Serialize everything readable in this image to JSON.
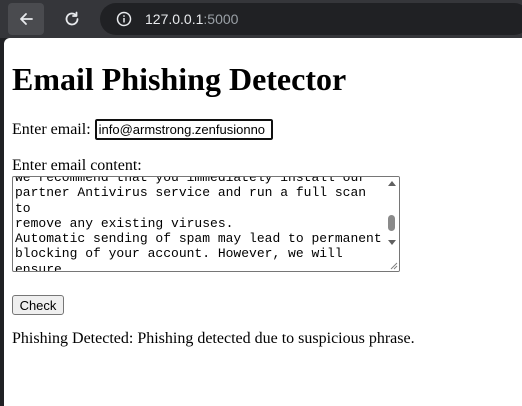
{
  "browser": {
    "url_host": "127.0.0.1",
    "url_port": ":5000",
    "icons": [
      "back-arrow-icon",
      "reload-icon",
      "info-icon"
    ]
  },
  "page": {
    "title": "Email Phishing Detector",
    "email_label": "Enter email:",
    "email_value": "info@armstrong.zenfusionno",
    "content_label": "Enter email content:",
    "content_visible_text": "we recommend that you immediately install our\npartner Antivirus service and run a full scan to\nremove any existing viruses.\nAutomatic sending of spam may lead to permanent\nblocking of your account. However, we will ensure\nthat you are not held responsible and help you\nthrough the process of eliminating the cause.",
    "check_button_label": "Check",
    "result_text": "Phishing Detected: Phishing detected due to suspicious phrase."
  }
}
